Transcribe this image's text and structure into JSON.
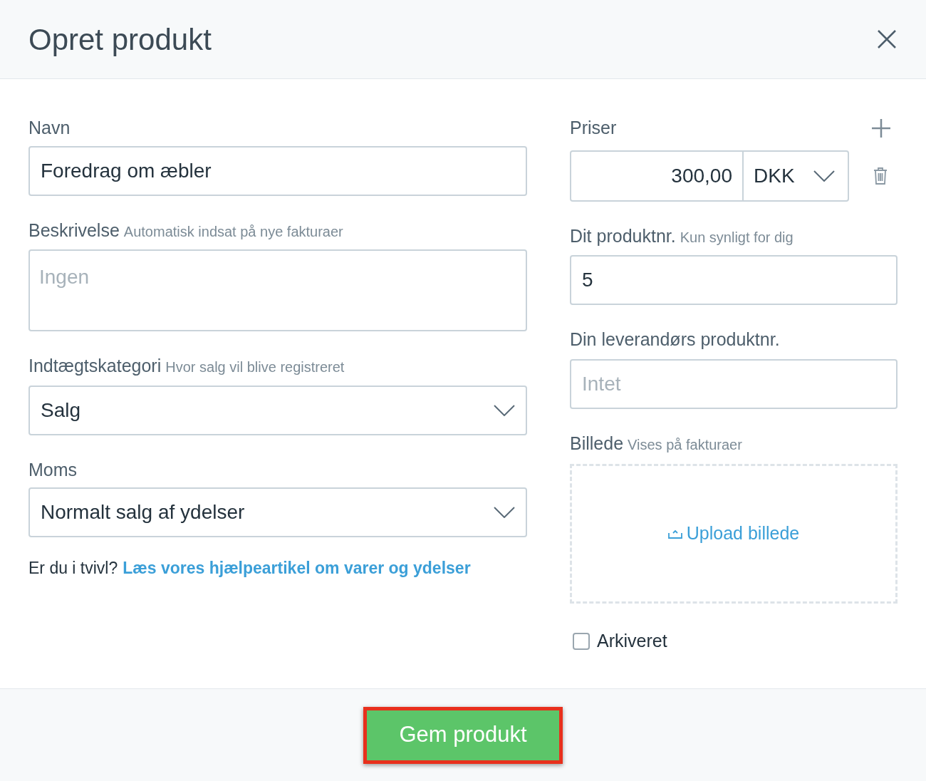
{
  "dialog": {
    "title": "Opret produkt"
  },
  "left": {
    "name": {
      "label": "Navn",
      "value": "Foredrag om æbler"
    },
    "description": {
      "label": "Beskrivelse",
      "hint": "Automatisk indsat på nye fakturaer",
      "placeholder": "Ingen"
    },
    "revenue_category": {
      "label": "Indtægtskategori",
      "hint": "Hvor salg vil blive registreret",
      "value": "Salg"
    },
    "vat": {
      "label": "Moms",
      "value": "Normalt salg af ydelser"
    },
    "help": {
      "text": "Er du i tvivl?",
      "link": "Læs vores hjælpeartikel om varer og ydelser"
    }
  },
  "right": {
    "prices": {
      "label": "Priser",
      "rows": [
        {
          "amount": "300,00",
          "currency": "DKK"
        }
      ]
    },
    "product_no": {
      "label": "Dit produktnr.",
      "hint": "Kun synligt for dig",
      "value": "5"
    },
    "supplier_no": {
      "label": "Din leverandørs produktnr.",
      "placeholder": "Intet"
    },
    "image": {
      "label": "Billede",
      "hint": "Vises på fakturaer",
      "upload": "Upload billede"
    },
    "archived": {
      "label": "Arkiveret",
      "checked": false
    }
  },
  "footer": {
    "save_button": {
      "label": "Gem produkt",
      "highlighted": true
    }
  }
}
